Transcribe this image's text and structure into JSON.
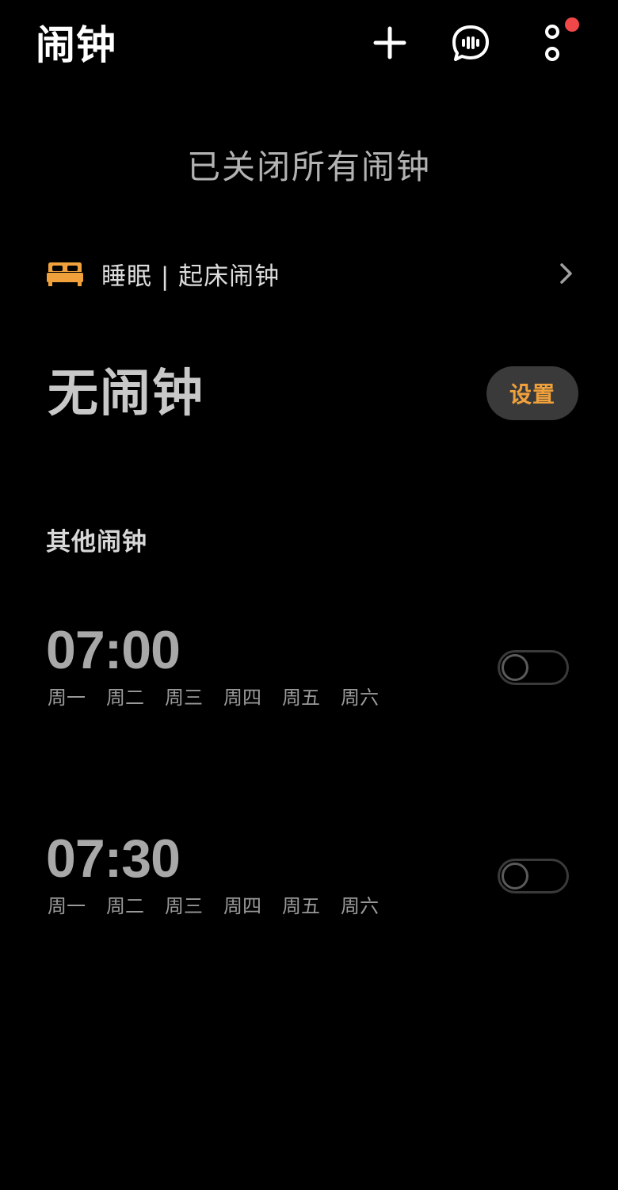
{
  "header": {
    "title": "闹钟",
    "icons": [
      "add-icon",
      "voice-icon",
      "more-icon"
    ],
    "notification_dot_color": "#f04848"
  },
  "status": {
    "text": "已关闭所有闹钟"
  },
  "sleep": {
    "icon": "bed-icon",
    "label": "睡眠 | 起床闹钟",
    "icon_color": "#f0a13c"
  },
  "bedtime": {
    "title": "无闹钟",
    "set_label": "设置",
    "accent": "#f0a13c"
  },
  "other_alarms": {
    "header": "其他闹钟",
    "items": [
      {
        "time": "07:00",
        "days": [
          "周一",
          "周二",
          "周三",
          "周四",
          "周五",
          "周六"
        ],
        "enabled": false
      },
      {
        "time": "07:30",
        "days": [
          "周一",
          "周二",
          "周三",
          "周四",
          "周五",
          "周六"
        ],
        "enabled": false
      }
    ]
  }
}
